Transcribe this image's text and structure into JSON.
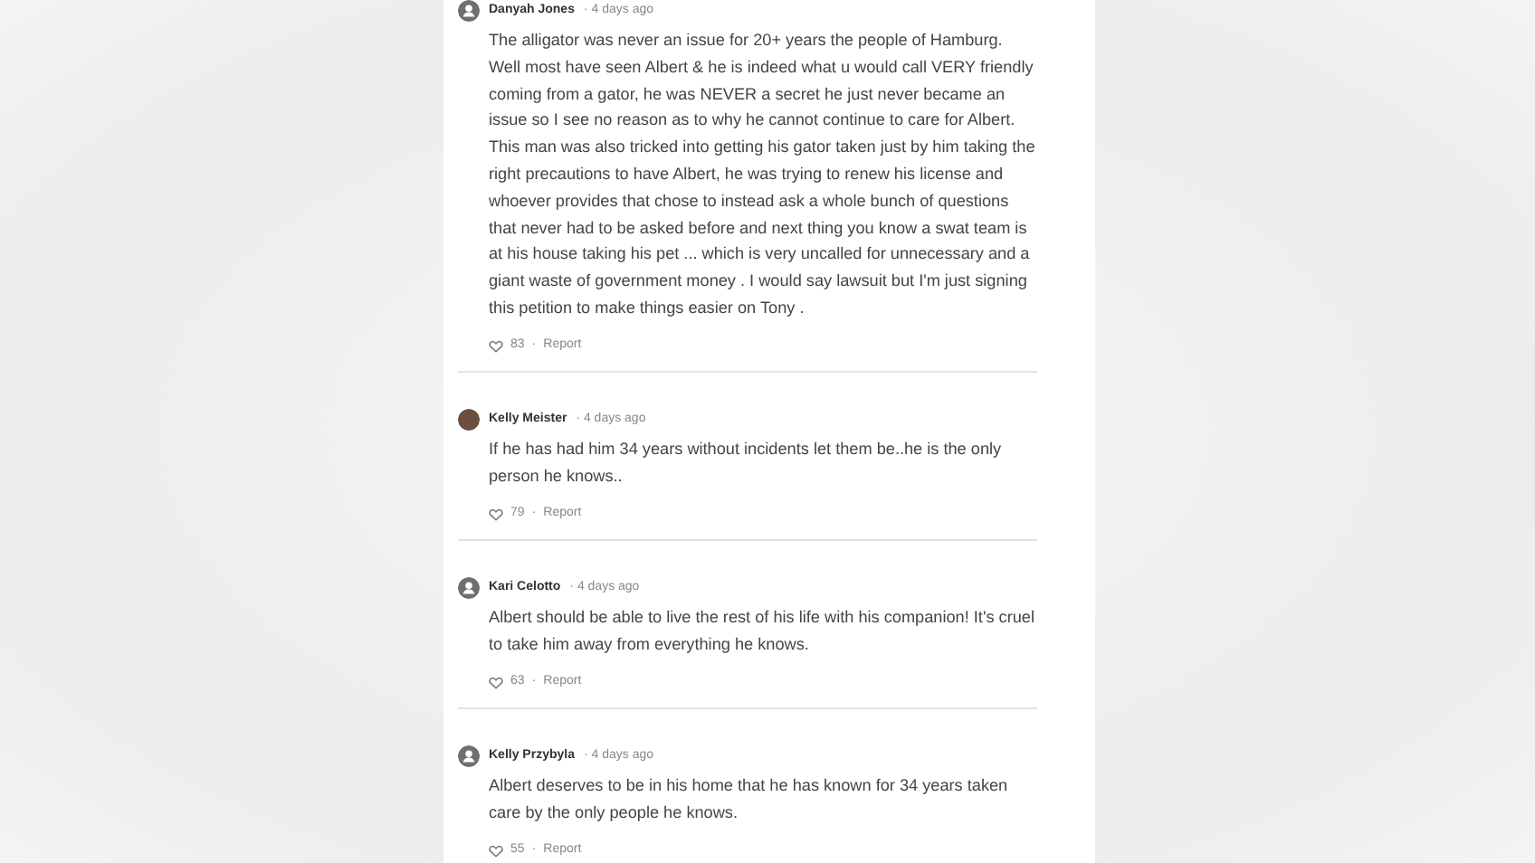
{
  "comments": [
    {
      "author": "Danyah Jones",
      "has_photo": false,
      "time": "· 4 days ago",
      "text": "The alligator was never an issue for 20+ years the people of Hamburg. Well most have seen Albert & he is indeed what u would call VERY friendly coming from a gator, he was NEVER a secret he just never became an issue so I see no reason as to why he cannot continue to care for Albert. This man was also tricked into getting his gator taken just by him taking the right precautions to have Albert, he was trying to renew his license and whoever provides that chose to instead ask a whole bunch of questions that never had to be asked before and next thing you know a swat team is at his house taking his pet ... which is very uncalled for unnecessary and a giant waste of government money . I would say lawsuit but I'm just signing this petition to make things easier on Tony .",
      "likes": "83",
      "separator": "·",
      "report": "Report"
    },
    {
      "author": "Kelly Meister",
      "has_photo": true,
      "time": "· 4 days ago",
      "text": "If he has had him 34 years without incidents let them be..he is the only person he knows..",
      "likes": "79",
      "separator": "·",
      "report": "Report"
    },
    {
      "author": "Kari Celotto",
      "has_photo": false,
      "time": "· 4 days ago",
      "text": "Albert should be able to live the rest of his life with his companion! It's cruel to take him away from everything he knows.",
      "likes": "63",
      "separator": "·",
      "report": "Report"
    },
    {
      "author": "Kelly Przybyla",
      "has_photo": false,
      "time": "· 4 days ago",
      "text": "Albert deserves to be in his home that he has known for 34 years taken care by the only people he knows.",
      "likes": "55",
      "separator": "·",
      "report": "Report"
    }
  ]
}
